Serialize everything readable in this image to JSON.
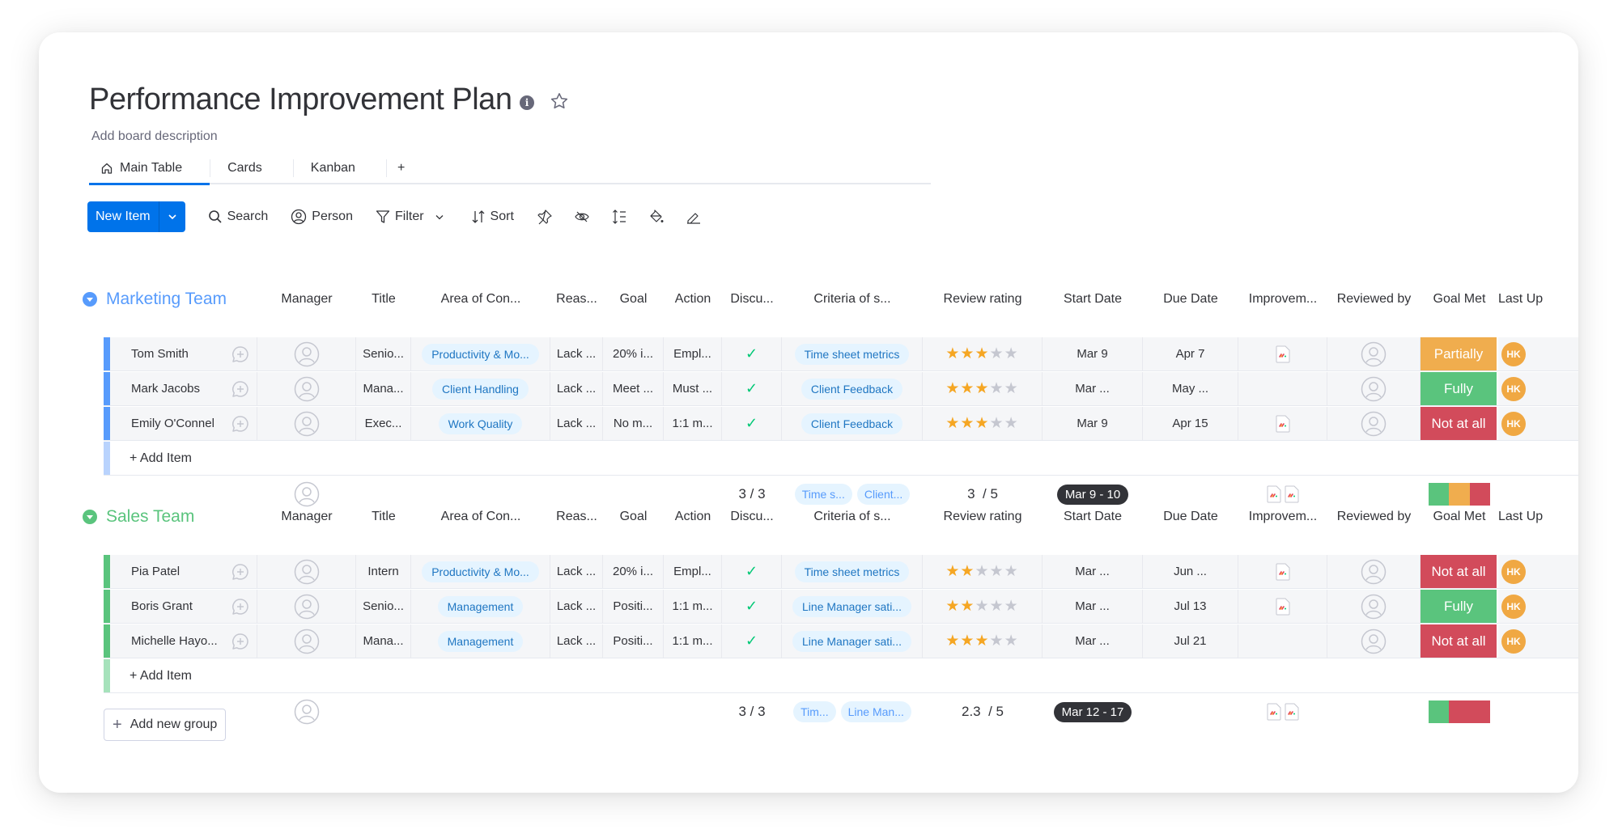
{
  "board": {
    "title": "Performance Improvement Plan",
    "description_placeholder": "Add board description",
    "info_icon": "info-icon",
    "favorite_icon": "star-outline-icon"
  },
  "tabs": [
    {
      "label": "Main Table",
      "icon": "home-icon",
      "active": true
    },
    {
      "label": "Cards",
      "active": false
    },
    {
      "label": "Kanban",
      "active": false
    },
    {
      "label": "+",
      "active": false
    }
  ],
  "toolbar": {
    "new_item": "New Item",
    "search": "Search",
    "person": "Person",
    "filter": "Filter",
    "sort": "Sort",
    "icons": [
      "pin-icon",
      "hide-icon",
      "row-height-icon",
      "color-fill-icon",
      "edit-icon"
    ]
  },
  "columns": [
    "Manager",
    "Title",
    "Area of Con...",
    "Reas...",
    "Goal",
    "Action",
    "Discu...",
    "Criteria of s...",
    "Review rating",
    "Start Date",
    "Due Date",
    "Improvem...",
    "Reviewed by",
    "Goal Met",
    "Last Up"
  ],
  "colors": {
    "marketing": "#579bfc",
    "sales": "#5ac47d",
    "status_partially": "#f0ad4e",
    "status_fully": "#5ac47d",
    "status_not_at_all": "#d24b5b",
    "avatar_hk": "#f0a843",
    "primary": "#0073ea"
  },
  "groups": [
    {
      "name": "Marketing Team",
      "color": "#579bfc",
      "bar_light": "#b9d3fd",
      "items": [
        {
          "name": "Tom Smith",
          "title": "Senio...",
          "area": "Productivity & Mo...",
          "reason": "Lack ...",
          "goal": "20% i...",
          "action": "Empl...",
          "discussed": "✓",
          "criteria": "Time sheet metrics",
          "rating": 3,
          "start": "Mar 9",
          "due": "Apr 7",
          "improvement_file": true,
          "goal_met": "Partially",
          "goal_met_color": "#f0ad4e",
          "last_updated": "HK"
        },
        {
          "name": "Mark Jacobs",
          "title": "Mana...",
          "area": "Client Handling",
          "reason": "Lack ...",
          "goal": "Meet ...",
          "action": "Must ...",
          "discussed": "✓",
          "criteria": "Client Feedback",
          "rating": 3,
          "start": "Mar ...",
          "due": "May ...",
          "improvement_file": false,
          "goal_met": "Fully",
          "goal_met_color": "#5ac47d",
          "last_updated": "HK"
        },
        {
          "name": "Emily O'Connel",
          "title": "Exec...",
          "area": "Work Quality",
          "reason": "Lack ...",
          "goal": "No m...",
          "action": "1:1 m...",
          "discussed": "✓",
          "criteria": "Client Feedback",
          "rating": 3,
          "start": "Mar 9",
          "due": "Apr 15",
          "improvement_file": true,
          "goal_met": "Not at all",
          "goal_met_color": "#d24b5b",
          "last_updated": "HK"
        }
      ],
      "add_item": "+ Add Item",
      "summary": {
        "discussed": "3 / 3",
        "criteria": [
          "Time s...",
          "Client..."
        ],
        "rating": "3  / 5",
        "timeline": "Mar 9 - 10",
        "files": 2,
        "goal_met_distribution": [
          {
            "label": "Fully",
            "fraction": 0.333,
            "color": "#5ac47d"
          },
          {
            "label": "Partially",
            "fraction": 0.333,
            "color": "#f0ad4e"
          },
          {
            "label": "Not at all",
            "fraction": 0.334,
            "color": "#d24b5b"
          }
        ]
      }
    },
    {
      "name": "Sales Team",
      "color": "#5ac47d",
      "bar_light": "#a6e2bb",
      "items": [
        {
          "name": "Pia Patel",
          "title": "Intern",
          "area": "Productivity & Mo...",
          "reason": "Lack ...",
          "goal": "20% i...",
          "action": "Empl...",
          "discussed": "✓",
          "criteria": "Time sheet metrics",
          "rating": 2,
          "start": "Mar ...",
          "due": "Jun ...",
          "improvement_file": true,
          "goal_met": "Not at all",
          "goal_met_color": "#d24b5b",
          "last_updated": "HK"
        },
        {
          "name": "Boris Grant",
          "title": "Senio...",
          "area": "Management",
          "reason": "Lack ...",
          "goal": "Positi...",
          "action": "1:1 m...",
          "discussed": "✓",
          "criteria": "Line Manager sati...",
          "rating": 2,
          "start": "Mar ...",
          "due": "Jul 13",
          "improvement_file": true,
          "goal_met": "Fully",
          "goal_met_color": "#5ac47d",
          "last_updated": "HK"
        },
        {
          "name": "Michelle Hayo...",
          "title": "Mana...",
          "area": "Management",
          "reason": "Lack ...",
          "goal": "Positi...",
          "action": "1:1 m...",
          "discussed": "✓",
          "criteria": "Line Manager sati...",
          "rating": 3,
          "start": "Mar ...",
          "due": "Jul 21",
          "improvement_file": false,
          "goal_met": "Not at all",
          "goal_met_color": "#d24b5b",
          "last_updated": "HK"
        }
      ],
      "add_item": "+ Add Item",
      "summary": {
        "discussed": "3 / 3",
        "criteria": [
          "Tim...",
          "Line Man..."
        ],
        "rating": "2.3  / 5",
        "timeline": "Mar 12 - 17",
        "files": 2,
        "goal_met_distribution": [
          {
            "label": "Fully",
            "fraction": 0.333,
            "color": "#5ac47d"
          },
          {
            "label": "Not at all",
            "fraction": 0.667,
            "color": "#d24b5b"
          }
        ]
      }
    }
  ],
  "add_new_group": "Add new group"
}
